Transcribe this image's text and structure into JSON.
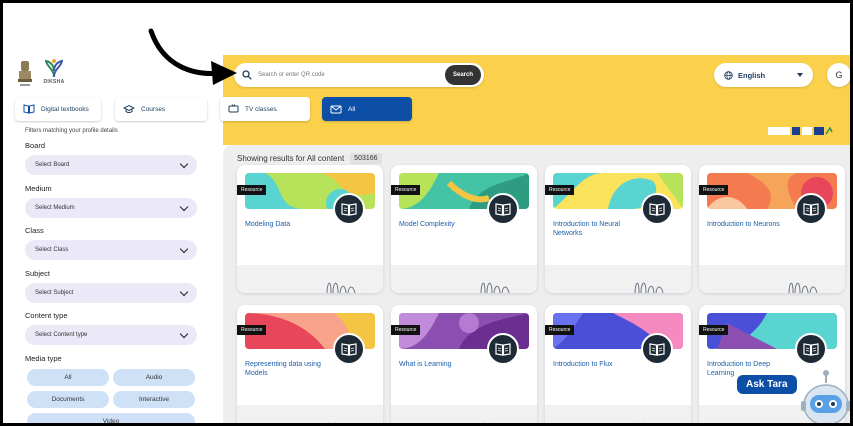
{
  "search": {
    "placeholder": "Search or enter QR code",
    "button_label": "Search"
  },
  "language": {
    "label": "English"
  },
  "user": {
    "initial": "G"
  },
  "brand": {
    "name": "DIKSHA"
  },
  "nav": {
    "tabs": [
      {
        "label": "Digital textbooks"
      },
      {
        "label": "Courses"
      },
      {
        "label": "TV classes"
      },
      {
        "label": "All"
      }
    ]
  },
  "sidebar": {
    "note": "Filters matching your profile details",
    "filters": [
      {
        "label": "Board",
        "placeholder": "Select Board"
      },
      {
        "label": "Medium",
        "placeholder": "Select Medium"
      },
      {
        "label": "Class",
        "placeholder": "Select Class"
      },
      {
        "label": "Subject",
        "placeholder": "Select Subject"
      },
      {
        "label": "Content type",
        "placeholder": "Select Content type"
      }
    ],
    "media_type": {
      "label": "Media type",
      "chips": [
        "All",
        "Audio",
        "Documents",
        "Interactive",
        "Video"
      ]
    }
  },
  "results": {
    "prefix": "Showing results for All content",
    "count": "503166"
  },
  "cards": [
    {
      "tag": "Resource",
      "title": "Modeling Data"
    },
    {
      "tag": "Resource",
      "title": "Model Complexity"
    },
    {
      "tag": "Resource",
      "title": "Introduction to Neural Networks"
    },
    {
      "tag": "Resource",
      "title": "Introduction to Neurons"
    },
    {
      "tag": "Resource",
      "title": "Representing data using Models"
    },
    {
      "tag": "Resource",
      "title": "What is Learning"
    },
    {
      "tag": "Resource",
      "title": "Introduction to Flux"
    },
    {
      "tag": "Resource",
      "title": "Introduction to Deep Learning"
    }
  ],
  "assistant": {
    "label": "Ask Tara"
  },
  "colors": {
    "header_yellow": "#fbd14b",
    "active_tab": "#0d4ea6",
    "link_blue": "#1b5fa8",
    "select_bg": "#ebe8f7",
    "chip_bg": "#cfe1f7"
  }
}
